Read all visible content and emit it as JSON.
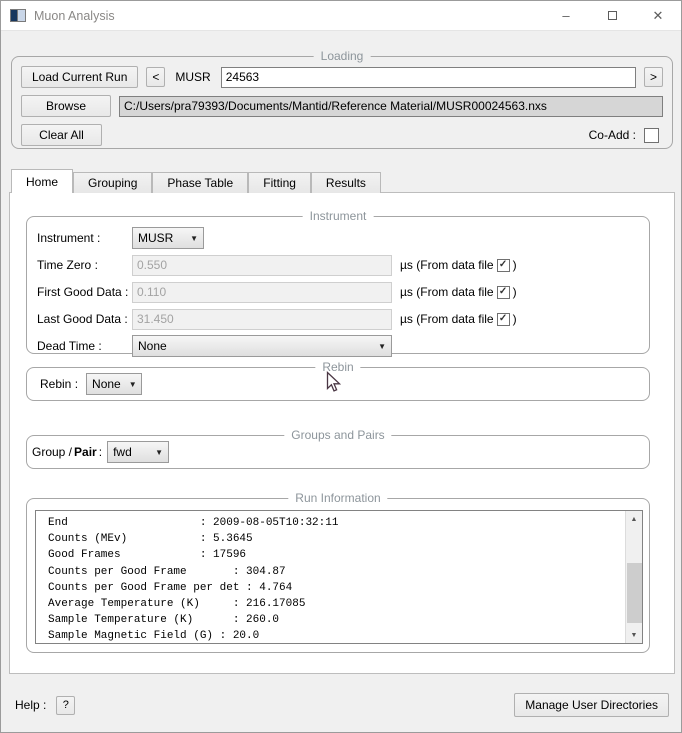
{
  "window": {
    "title": "Muon Analysis"
  },
  "icons": {
    "minimize": "–",
    "close": "✕",
    "dropdown_arrow": "▼",
    "check": "✓",
    "scroll_up": "▲",
    "scroll_down": "▼"
  },
  "loading": {
    "legend": "Loading",
    "load_current_run_label": "Load Current Run",
    "prev_label": "<",
    "next_label": ">",
    "instrument_prefix": "MUSR",
    "run_number": "24563",
    "browse_label": "Browse",
    "file_path": "C:/Users/pra79393/Documents/Mantid/Reference Material/MUSR00024563.nxs",
    "clear_all_label": "Clear All",
    "co_add_label": "Co-Add :"
  },
  "tabs": [
    {
      "label": "Home",
      "selected": true
    },
    {
      "label": "Grouping",
      "selected": false
    },
    {
      "label": "Phase Table",
      "selected": false
    },
    {
      "label": "Fitting",
      "selected": false
    },
    {
      "label": "Results",
      "selected": false
    }
  ],
  "instrument": {
    "legend": "Instrument",
    "instrument_label": "Instrument :",
    "instrument_value": "MUSR",
    "rows": [
      {
        "label": "Time Zero :",
        "value": "0.550",
        "suffix_pre": "µs (From data file",
        "suffix_post": ")",
        "checked": true
      },
      {
        "label": "First Good Data :",
        "value": "0.110",
        "suffix_pre": "µs (From data file",
        "suffix_post": ")",
        "checked": true
      },
      {
        "label": "Last Good Data :",
        "value": "31.450",
        "suffix_pre": "µs (From data file",
        "suffix_post": ")",
        "checked": true
      }
    ],
    "dead_time_label": "Dead Time :",
    "dead_time_value": "None"
  },
  "rebin": {
    "legend": "Rebin",
    "label": "Rebin :",
    "value": "None"
  },
  "groups_pairs": {
    "legend": "Groups and Pairs",
    "label_prefix": "Group / ",
    "label_bold": "Pair",
    "label_suffix": " :",
    "value": "fwd"
  },
  "run_information": {
    "legend": "Run Information",
    "lines": [
      "End                    : 2009-08-05T10:32:11",
      "Counts (MEv)           : 5.3645",
      "Good Frames            : 17596",
      "Counts per Good Frame       : 304.87",
      "Counts per Good Frame per det : 4.764",
      "Average Temperature (K)     : 216.17085",
      "Sample Temperature (K)      : 260.0",
      "Sample Magnetic Field (G) : 20.0"
    ]
  },
  "footer": {
    "help_label": "Help :",
    "help_button_label": "?",
    "manage_button_label": "Manage User Directories"
  }
}
